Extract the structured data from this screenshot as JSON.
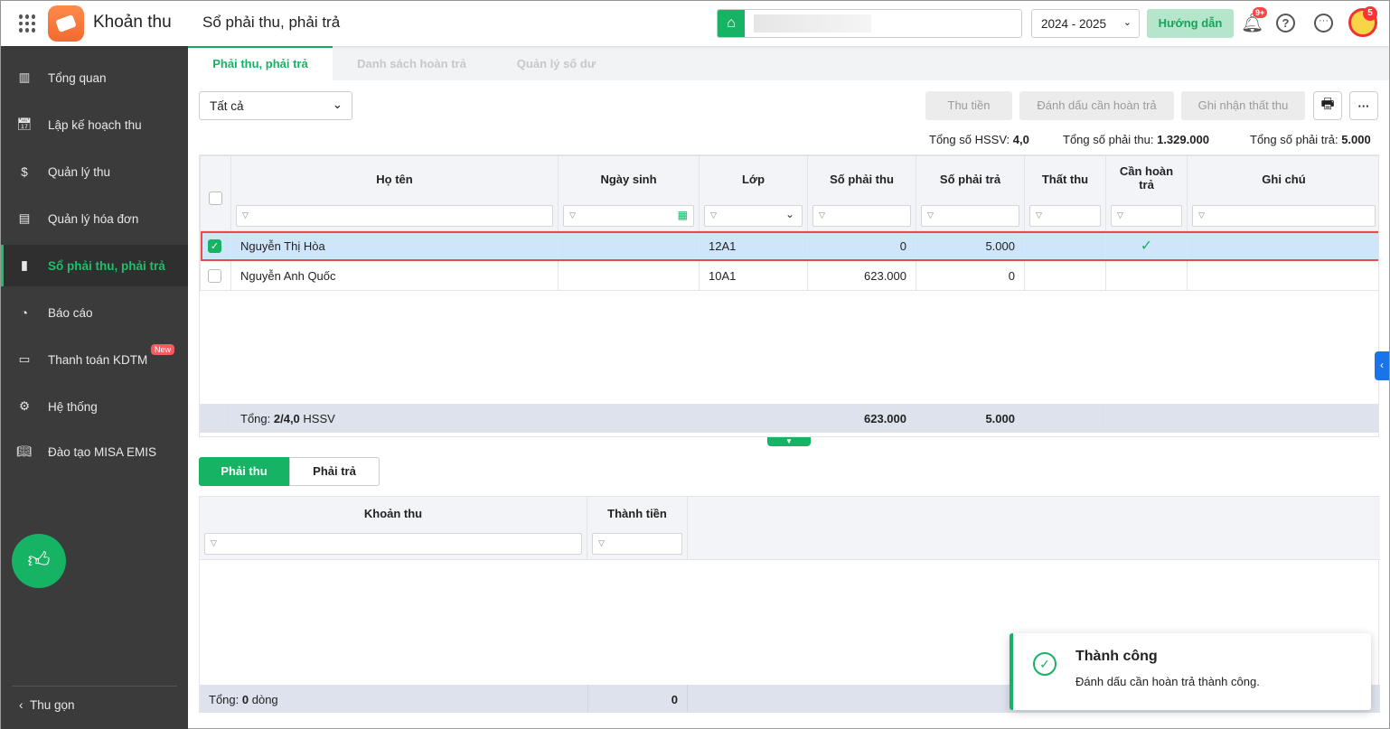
{
  "header": {
    "app_name": "Khoản thu",
    "page_title": "Sổ phải thu, phải trả",
    "school_year": "2024 - 2025",
    "guide_label": "Hướng dẫn",
    "notification_badge": "9+",
    "avatar_badge": "5"
  },
  "sidebar": {
    "items": [
      {
        "label": "Tổng quan"
      },
      {
        "label": "Lập kế hoạch thu"
      },
      {
        "label": "Quản lý thu"
      },
      {
        "label": "Quản lý hóa đơn"
      },
      {
        "label": "Sổ phải thu, phải trả"
      },
      {
        "label": "Báo cáo"
      },
      {
        "label": "Thanh toán KDTM",
        "badge": "New"
      },
      {
        "label": "Hệ thống"
      },
      {
        "label": "Đào tạo MISA EMIS"
      }
    ],
    "collapse_label": "Thu gọn"
  },
  "tabs": [
    {
      "label": "Phải thu, phải trả"
    },
    {
      "label": "Danh sách hoàn trả"
    },
    {
      "label": "Quản lý số dư"
    }
  ],
  "toolbar": {
    "filter_value": "Tất cả",
    "collect_label": "Thu tiền",
    "mark_refund_label": "Đánh dấu cần hoàn trả",
    "record_loss_label": "Ghi nhận thất thu"
  },
  "summary": {
    "students_label": "Tổng số HSSV:",
    "students_value": "4,0",
    "receivable_label": "Tổng số phải thu:",
    "receivable_value": "1.329.000",
    "payable_label": "Tổng số phải trả:",
    "payable_value": "5.000"
  },
  "table": {
    "columns": [
      "Họ tên",
      "Ngày sinh",
      "Lớp",
      "Số phải thu",
      "Số phải trả",
      "Thất thu",
      "Cần hoàn trả",
      "Ghi chú"
    ],
    "rows": [
      {
        "name": "Nguyễn Thị Hòa",
        "dob": "",
        "class": "12A1",
        "receivable": "0",
        "payable": "5.000",
        "loss": "",
        "refund": true,
        "note": "",
        "checked": true
      },
      {
        "name": "Nguyễn Anh Quốc",
        "dob": "",
        "class": "10A1",
        "receivable": "623.000",
        "payable": "0",
        "loss": "",
        "refund": false,
        "note": "",
        "checked": false
      }
    ],
    "footer": {
      "label": "Tổng:",
      "count": "2/4,0",
      "unit": "HSSV",
      "receivable": "623.000",
      "payable": "5.000"
    }
  },
  "detail": {
    "tabs": [
      "Phải thu",
      "Phải trả"
    ],
    "columns": [
      "Khoản thu",
      "Thành tiền"
    ],
    "footer": {
      "label": "Tổng:",
      "count": "0",
      "unit": "dòng",
      "amount": "0"
    }
  },
  "toast": {
    "title": "Thành công",
    "message": "Đánh dấu cần hoàn trả thành công."
  },
  "colors": {
    "accent": "#16b364",
    "sidebar": "#3b3b3b",
    "selected_row": "#cfe6fa"
  }
}
